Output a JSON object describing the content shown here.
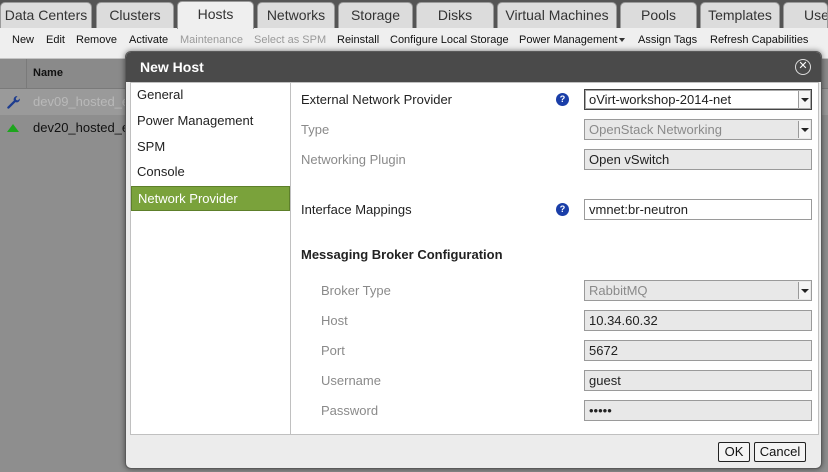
{
  "main_tabs": [
    {
      "label": "Data Centers"
    },
    {
      "label": "Clusters"
    },
    {
      "label": "Hosts",
      "active": true
    },
    {
      "label": "Networks"
    },
    {
      "label": "Storage"
    },
    {
      "label": "Disks"
    },
    {
      "label": "Virtual Machines"
    },
    {
      "label": "Pools"
    },
    {
      "label": "Templates"
    },
    {
      "label": "Use"
    }
  ],
  "toolbar": {
    "items": [
      {
        "label": "New"
      },
      {
        "label": "Edit"
      },
      {
        "label": "Remove"
      },
      {
        "label": "Activate"
      },
      {
        "label": "Maintenance",
        "disabled": true
      },
      {
        "label": "Select as SPM",
        "disabled": true
      },
      {
        "label": "Reinstall"
      },
      {
        "label": "Configure Local Storage"
      },
      {
        "label": "Power Management"
      },
      {
        "label": "Assign Tags"
      },
      {
        "label": "Refresh Capabilities"
      }
    ]
  },
  "grid": {
    "name_header": "Name",
    "rows": [
      {
        "name": "dev09_hosted_e",
        "status_icon": "wrench-icon"
      },
      {
        "name": "dev20_hosted_e",
        "status_icon": "up-arrow-icon"
      }
    ]
  },
  "modal": {
    "title": "New Host",
    "close_glyph": "✕",
    "side_items": [
      {
        "label": "General"
      },
      {
        "label": "Power Management"
      },
      {
        "label": "SPM"
      },
      {
        "label": "Console"
      },
      {
        "label": "Network Provider",
        "active": true
      }
    ],
    "help_glyph": "?",
    "external_network_provider": {
      "label": "External Network Provider",
      "value": "oVirt-workshop-2014-net"
    },
    "type": {
      "label": "Type",
      "value": "OpenStack Networking"
    },
    "networking_plugin": {
      "label": "Networking Plugin",
      "value": "Open vSwitch"
    },
    "interface_mappings": {
      "label": "Interface Mappings",
      "value": "vmnet:br-neutron"
    },
    "messaging_section_title": "Messaging Broker Configuration",
    "broker_type": {
      "label": "Broker Type",
      "value": "RabbitMQ"
    },
    "host": {
      "label": "Host",
      "value": "10.34.60.32"
    },
    "port": {
      "label": "Port",
      "value": "5672"
    },
    "username": {
      "label": "Username",
      "value": "guest"
    },
    "password": {
      "label": "Password",
      "value": "•••••"
    },
    "ok_label": "OK",
    "cancel_label": "Cancel"
  },
  "colors": {
    "active_side_item": "#7aa23b",
    "modal_title_bar": "#4a4a4a",
    "help_icon": "#1a3ea8",
    "status_up": "#1da51d"
  }
}
